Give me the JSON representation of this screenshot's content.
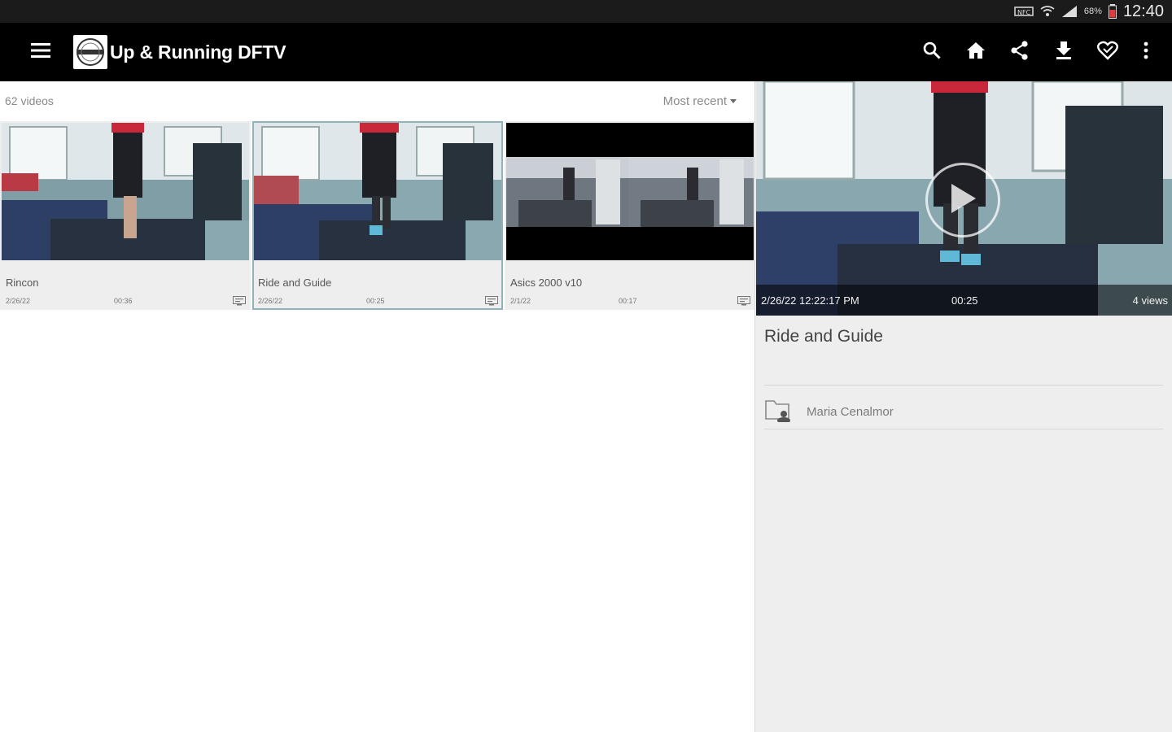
{
  "status_bar": {
    "battery_text": "68%",
    "time": "12:40"
  },
  "app_bar": {
    "title": "Up & Running DFTV",
    "icons": [
      "menu-icon",
      "search-icon",
      "home-icon",
      "share-icon",
      "download-icon",
      "favorite-icon",
      "more-vert-icon"
    ]
  },
  "list": {
    "count_label": "62 videos",
    "sort_label": "Most recent",
    "videos": [
      {
        "title": "Rincon",
        "date": "2/26/22",
        "duration": "00:36"
      },
      {
        "title": "Ride and Guide",
        "date": "2/26/22",
        "duration": "00:25"
      },
      {
        "title": "Asics 2000 v10",
        "date": "2/1/22",
        "duration": "00:17"
      }
    ]
  },
  "detail": {
    "date": "2/26/22 12:22:17 PM",
    "duration": "00:25",
    "views": "4 views",
    "title": "Ride and Guide",
    "channel": "Maria Cenalmor"
  },
  "colors": {
    "app_bar": "#000000",
    "status_bar": "#1b1b1b",
    "pane_bg": "#eeeeee",
    "selected_outline": "#8fb3b8",
    "accent_red": "#c8283a"
  }
}
